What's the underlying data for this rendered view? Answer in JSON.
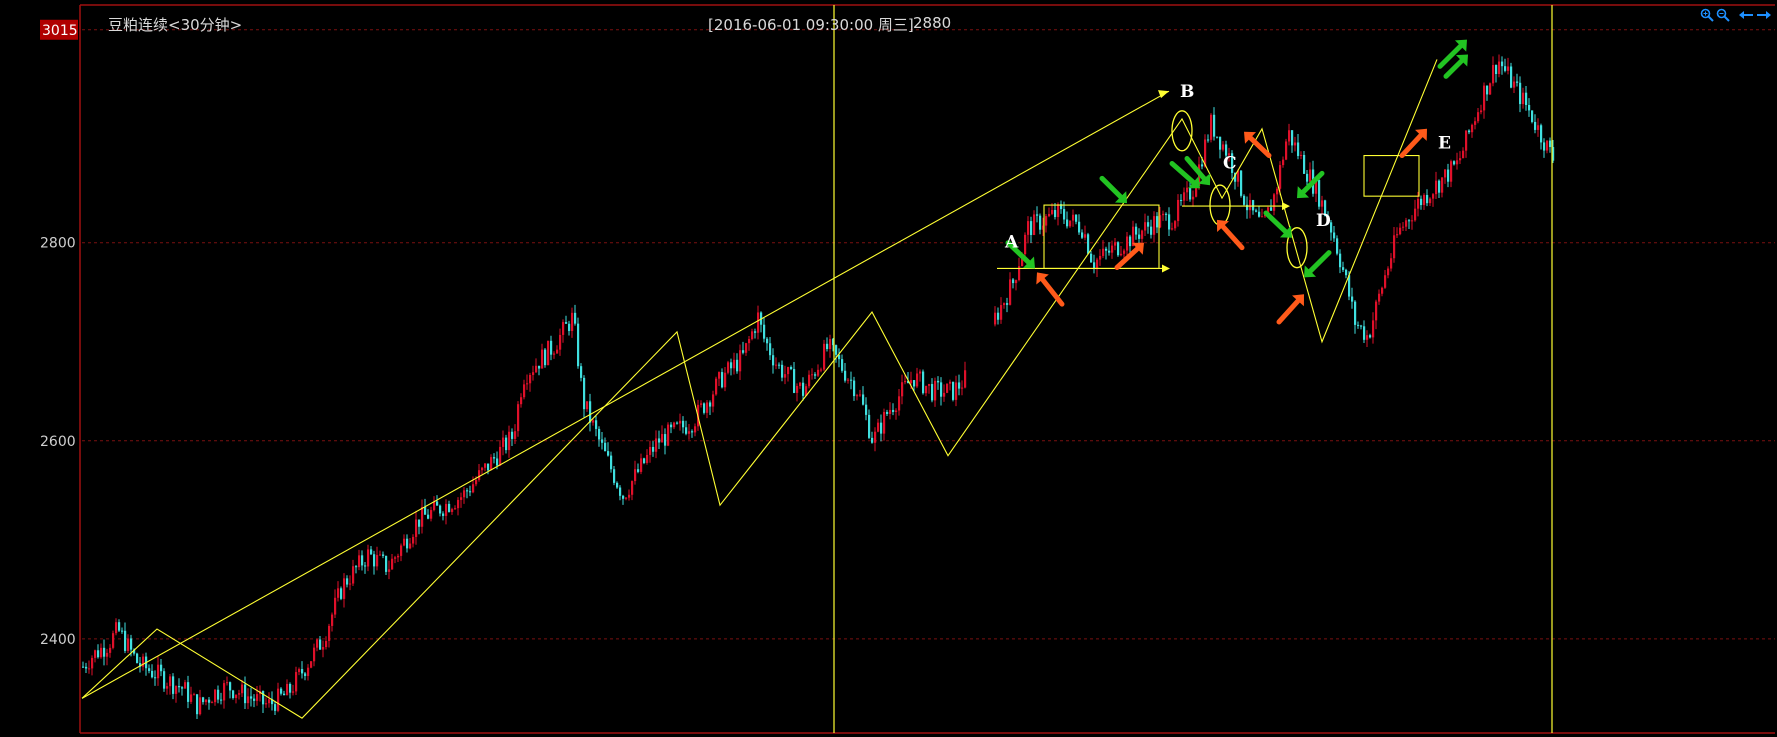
{
  "header": {
    "symbol_title": "豆粕连续<30分钟>",
    "cursor_time": "[2016-06-01  09:30:00 周三]",
    "cursor_value": "2880"
  },
  "toolbar": {
    "zoom_in_icon": "zoom-in-icon",
    "zoom_out_icon": "zoom-out-icon",
    "pan_left_icon": "arrow-left-icon",
    "pan_right_icon": "arrow-right-icon"
  },
  "colors": {
    "background": "#000000",
    "up_candle": "#e0102a",
    "down_candle": "#40e0e0",
    "annotation": "#ffff33",
    "grid": "#7a1010",
    "arrow_green": "#22c322",
    "arrow_orange": "#ff5a1a",
    "price_tag_bg": "#b00000"
  },
  "chart_data": {
    "type": "candlestick",
    "title": "豆粕连续<30分钟>",
    "ylim": [
      2305,
      3040
    ],
    "y_ticks": [
      2400,
      2600,
      2800
    ],
    "y_tick_labels": [
      "2400",
      "2600",
      "2800"
    ],
    "current_price_label": "3015",
    "grid": true,
    "price_path": [
      [
        0,
        2372
      ],
      [
        8,
        2382
      ],
      [
        25,
        2395
      ],
      [
        35,
        2409
      ],
      [
        55,
        2375
      ],
      [
        85,
        2358
      ],
      [
        100,
        2350
      ],
      [
        115,
        2332
      ],
      [
        130,
        2345
      ],
      [
        145,
        2352
      ],
      [
        165,
        2342
      ],
      [
        185,
        2333
      ],
      [
        205,
        2345
      ],
      [
        240,
        2400
      ],
      [
        260,
        2455
      ],
      [
        285,
        2485
      ],
      [
        305,
        2472
      ],
      [
        335,
        2520
      ],
      [
        380,
        2545
      ],
      [
        405,
        2575
      ],
      [
        430,
        2605
      ],
      [
        440,
        2665
      ],
      [
        470,
        2695
      ],
      [
        490,
        2725
      ],
      [
        500,
        2640
      ],
      [
        520,
        2590
      ],
      [
        540,
        2545
      ],
      [
        575,
        2600
      ],
      [
        610,
        2620
      ],
      [
        640,
        2665
      ],
      [
        660,
        2685
      ],
      [
        675,
        2725
      ],
      [
        680,
        2705
      ],
      [
        695,
        2675
      ],
      [
        720,
        2650
      ],
      [
        745,
        2695
      ],
      [
        775,
        2650
      ],
      [
        790,
        2600
      ],
      [
        805,
        2630
      ],
      [
        830,
        2665
      ],
      [
        850,
        2650
      ],
      [
        870,
        2650
      ],
      [
        885,
        2665
      ],
      [
        900,
        2695
      ],
      [
        910,
        2720
      ],
      [
        930,
        2760
      ],
      [
        945,
        2815
      ],
      [
        975,
        2830
      ],
      [
        1000,
        2815
      ],
      [
        1010,
        2780
      ],
      [
        1040,
        2800
      ],
      [
        1070,
        2820
      ],
      [
        1090,
        2825
      ],
      [
        1110,
        2855
      ],
      [
        1128,
        2920
      ],
      [
        1145,
        2890
      ],
      [
        1165,
        2835
      ],
      [
        1180,
        2815
      ],
      [
        1192,
        2850
      ],
      [
        1205,
        2912
      ],
      [
        1220,
        2880
      ],
      [
        1235,
        2850
      ],
      [
        1250,
        2810
      ],
      [
        1262,
        2765
      ],
      [
        1272,
        2720
      ],
      [
        1285,
        2705
      ],
      [
        1300,
        2760
      ],
      [
        1315,
        2810
      ],
      [
        1335,
        2840
      ],
      [
        1355,
        2860
      ],
      [
        1375,
        2880
      ],
      [
        1400,
        2950
      ],
      [
        1415,
        2985
      ],
      [
        1430,
        2960
      ],
      [
        1445,
        2935
      ],
      [
        1460,
        2905
      ],
      [
        1470,
        2885
      ]
    ],
    "gaps": [
      [
        882,
        912
      ]
    ],
    "vertical_lines": [
      752,
      1470
    ],
    "horizontal_segments": [
      {
        "x": [
          915,
          1080
        ],
        "y": 2774,
        "arrow": true
      },
      {
        "x": [
          1100,
          1200
        ],
        "y": 2837,
        "arrow": true
      }
    ],
    "zigzag": [
      [
        0,
        2340
      ],
      [
        75,
        2410
      ],
      [
        220,
        2320
      ],
      [
        595,
        2710
      ],
      [
        638,
        2535
      ],
      [
        790,
        2730
      ],
      [
        866,
        2585
      ],
      [
        1100,
        2925
      ],
      [
        1140,
        2845
      ],
      [
        1180,
        2915
      ],
      [
        1240,
        2700
      ],
      [
        1355,
        2985
      ]
    ],
    "long_trendline": [
      [
        0,
        2340
      ],
      [
        1087,
        2953
      ]
    ],
    "boxes": [
      {
        "x": [
          962,
          1077
        ],
        "y": [
          2774,
          2838
        ]
      },
      {
        "x": [
          1282,
          1337
        ],
        "y": [
          2847,
          2888
        ]
      }
    ],
    "circles": [
      {
        "x": 1100,
        "y": 2913
      },
      {
        "x": 1138,
        "y": 2838
      },
      {
        "x": 1215,
        "y": 2795
      }
    ],
    "labels": [
      {
        "text": "A",
        "x": 923,
        "y": 2795
      },
      {
        "text": "B",
        "x": 1098,
        "y": 2947
      },
      {
        "text": "C",
        "x": 1141,
        "y": 2875
      },
      {
        "text": "D",
        "x": 1234,
        "y": 2817
      },
      {
        "text": "E",
        "x": 1356,
        "y": 2895
      }
    ],
    "arrows": [
      {
        "color": "green",
        "from": [
          926,
          2800
        ],
        "to": [
          953,
          2774
        ]
      },
      {
        "color": "orange",
        "from": [
          980,
          2738
        ],
        "to": [
          955,
          2770
        ]
      },
      {
        "color": "green",
        "from": [
          1020,
          2865
        ],
        "to": [
          1045,
          2840
        ]
      },
      {
        "color": "orange",
        "from": [
          1035,
          2775
        ],
        "to": [
          1062,
          2800
        ]
      },
      {
        "color": "green",
        "from": [
          1090,
          2880
        ],
        "to": [
          1118,
          2855
        ]
      },
      {
        "color": "green",
        "from": [
          1105,
          2885
        ],
        "to": [
          1128,
          2858
        ]
      },
      {
        "color": "orange",
        "from": [
          1160,
          2795
        ],
        "to": [
          1135,
          2823
        ]
      },
      {
        "color": "orange",
        "from": [
          1187,
          2888
        ],
        "to": [
          1162,
          2912
        ]
      },
      {
        "color": "green",
        "from": [
          1184,
          2830
        ],
        "to": [
          1210,
          2805
        ]
      },
      {
        "color": "green",
        "from": [
          1240,
          2870
        ],
        "to": [
          1215,
          2845
        ]
      },
      {
        "color": "green",
        "from": [
          1247,
          2790
        ],
        "to": [
          1222,
          2765
        ]
      },
      {
        "color": "orange",
        "from": [
          1197,
          2720
        ],
        "to": [
          1222,
          2748
        ]
      },
      {
        "color": "orange",
        "from": [
          1320,
          2888
        ],
        "to": [
          1345,
          2915
        ]
      },
      {
        "color": "green",
        "from": [
          1358,
          2978
        ],
        "to": [
          1385,
          3005
        ]
      },
      {
        "color": "green",
        "from": [
          1364,
          2968
        ],
        "to": [
          1386,
          2990
        ]
      }
    ]
  }
}
